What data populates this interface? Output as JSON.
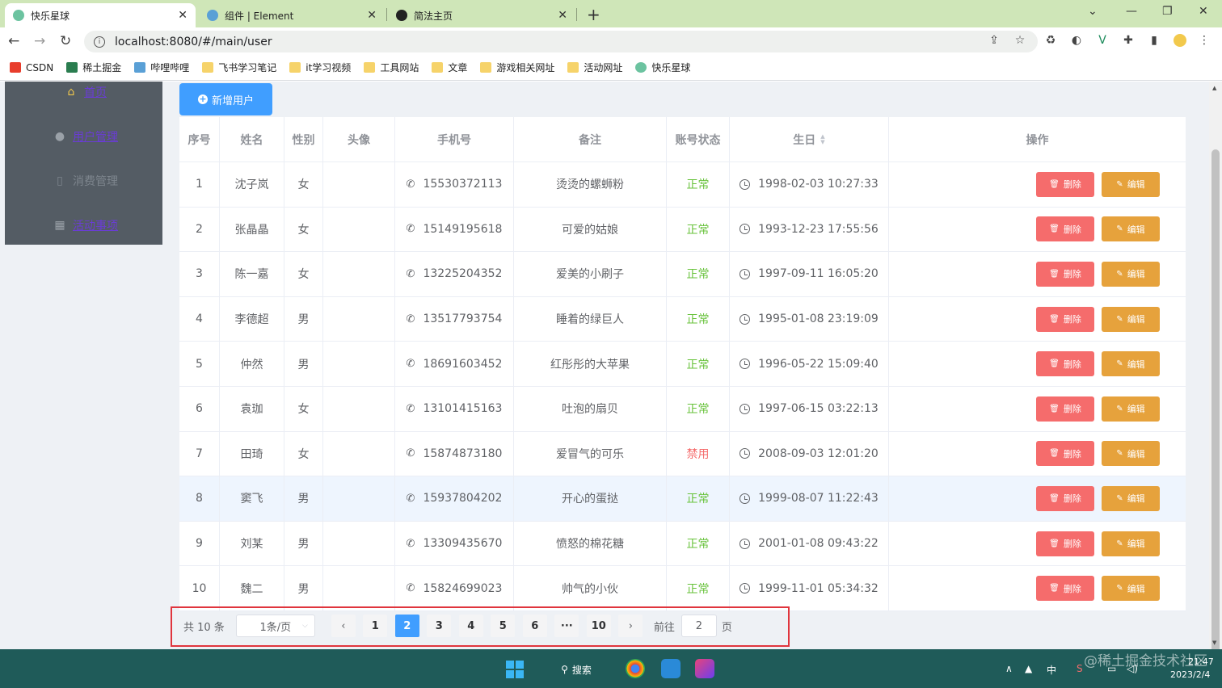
{
  "browser": {
    "tabs": [
      {
        "title": "快乐星球"
      },
      {
        "title": "组件 | Element"
      },
      {
        "title": "简法主页"
      }
    ],
    "url": "localhost:8080/#/main/user",
    "bookmarks": [
      "CSDN",
      "稀土掘金",
      "哔哩哔哩",
      "飞书学习笔记",
      "it学习视频",
      "工具网站",
      "文章",
      "游戏相关网址",
      "活动网址",
      "快乐星球"
    ]
  },
  "sidebar": {
    "items": [
      {
        "label": "首页"
      },
      {
        "label": "用户管理"
      },
      {
        "label": "消费管理"
      },
      {
        "label": "活动事项"
      }
    ]
  },
  "toolbar": {
    "add_label": "新增用户"
  },
  "table": {
    "headers": [
      "序号",
      "姓名",
      "性别",
      "头像",
      "手机号",
      "备注",
      "账号状态",
      "生日",
      "操作"
    ],
    "delete_label": "删除",
    "edit_label": "编辑",
    "rows": [
      {
        "no": "1",
        "name": "沈子岚",
        "gender": "女",
        "phone": "15530372113",
        "note": "烫烫的螺蛳粉",
        "status": "正常",
        "birthday": "1998-02-03 10:27:33"
      },
      {
        "no": "2",
        "name": "张晶晶",
        "gender": "女",
        "phone": "15149195618",
        "note": "可爱的姑娘",
        "status": "正常",
        "birthday": "1993-12-23 17:55:56"
      },
      {
        "no": "3",
        "name": "陈一嘉",
        "gender": "女",
        "phone": "13225204352",
        "note": "爱美的小刷子",
        "status": "正常",
        "birthday": "1997-09-11 16:05:20"
      },
      {
        "no": "4",
        "name": "李德超",
        "gender": "男",
        "phone": "13517793754",
        "note": "睡着的绿巨人",
        "status": "正常",
        "birthday": "1995-01-08 23:19:09"
      },
      {
        "no": "5",
        "name": "仲然",
        "gender": "男",
        "phone": "18691603452",
        "note": "红彤彤的大苹果",
        "status": "正常",
        "birthday": "1996-05-22 15:09:40"
      },
      {
        "no": "6",
        "name": "袁珈",
        "gender": "女",
        "phone": "13101415163",
        "note": "吐泡的扇贝",
        "status": "正常",
        "birthday": "1997-06-15 03:22:13"
      },
      {
        "no": "7",
        "name": "田琦",
        "gender": "女",
        "phone": "15874873180",
        "note": "爱冒气的可乐",
        "status": "禁用",
        "birthday": "2008-09-03 12:01:20"
      },
      {
        "no": "8",
        "name": "窦飞",
        "gender": "男",
        "phone": "15937804202",
        "note": "开心的蛋挞",
        "status": "正常",
        "birthday": "1999-08-07 11:22:43"
      },
      {
        "no": "9",
        "name": "刘某",
        "gender": "男",
        "phone": "13309435670",
        "note": "愤怒的棉花糖",
        "status": "正常",
        "birthday": "2001-01-08 09:43:22"
      },
      {
        "no": "10",
        "name": "魏二",
        "gender": "男",
        "phone": "15824699023",
        "note": "帅气的小伙",
        "status": "正常",
        "birthday": "1999-11-01 05:34:32"
      }
    ]
  },
  "pagination": {
    "total": "共 10 条",
    "page_size": "1条/页",
    "pages": [
      "1",
      "2",
      "3",
      "4",
      "5",
      "6",
      "···",
      "10"
    ],
    "current": "2",
    "goto_label": "前往",
    "goto_value": "2",
    "page_suffix": "页"
  },
  "taskbar": {
    "search_label": "搜索",
    "ime": "中",
    "time": "21:47",
    "date": "2023/2/4"
  },
  "watermark": "@稀土掘金技术社区",
  "colors": {
    "primary": "#409eff",
    "danger": "#f56c6c",
    "warning": "#e6a23c",
    "success": "#67c23a",
    "sidebar": "#545c64"
  }
}
